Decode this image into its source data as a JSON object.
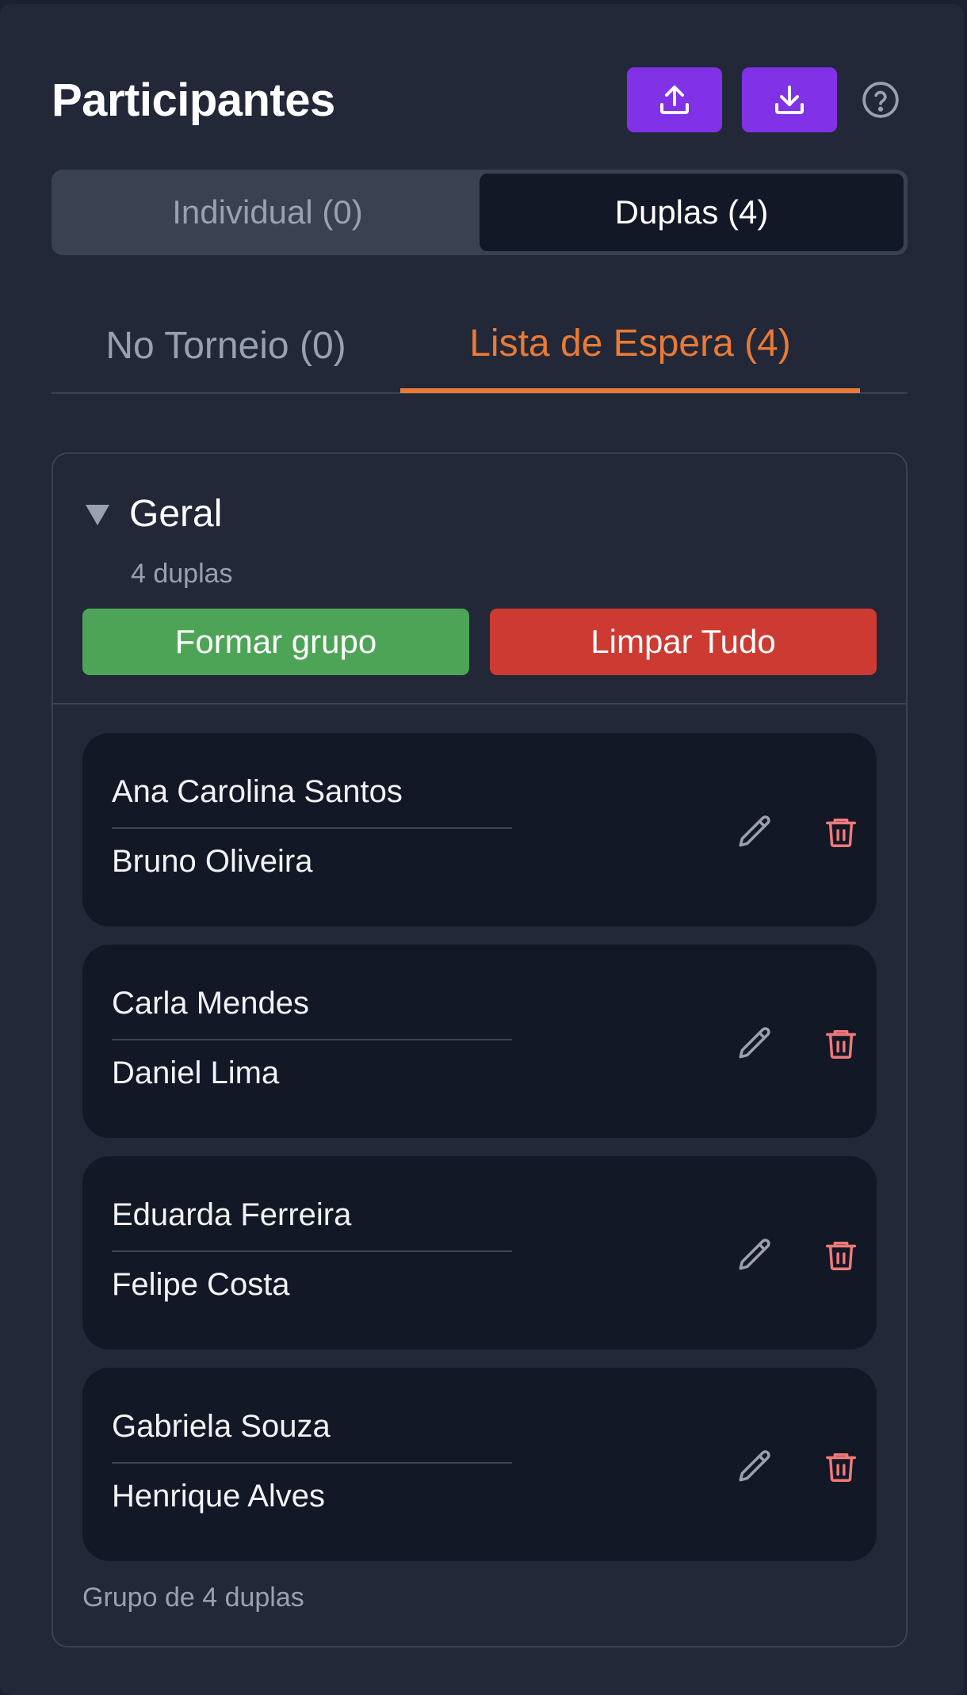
{
  "header": {
    "title": "Participantes",
    "upload_icon": "upload-icon",
    "download_icon": "download-icon",
    "help_icon": "help-circle-icon",
    "accent_color": "#8132e6"
  },
  "mode_toggle": {
    "options": [
      {
        "label": "Individual (0)",
        "active": false
      },
      {
        "label": "Duplas (4)",
        "active": true
      }
    ]
  },
  "tabs": [
    {
      "label": "No Torneio (0)",
      "active": false
    },
    {
      "label": "Lista de Espera (4)",
      "active": true
    }
  ],
  "tab_active_color": "#ea7a35",
  "group": {
    "title": "Geral",
    "count_label": "4 duplas",
    "collapse_icon": "triangle-down-icon",
    "form_button": "Formar grupo",
    "clear_button": "Limpar Tudo",
    "footer": "Grupo de 4 duplas",
    "pairs": [
      {
        "player1": "Ana Carolina Santos",
        "player2": "Bruno Oliveira"
      },
      {
        "player1": "Carla Mendes",
        "player2": "Daniel Lima"
      },
      {
        "player1": "Eduarda Ferreira",
        "player2": "Felipe Costa"
      },
      {
        "player1": "Gabriela Souza",
        "player2": "Henrique Alves"
      }
    ]
  }
}
